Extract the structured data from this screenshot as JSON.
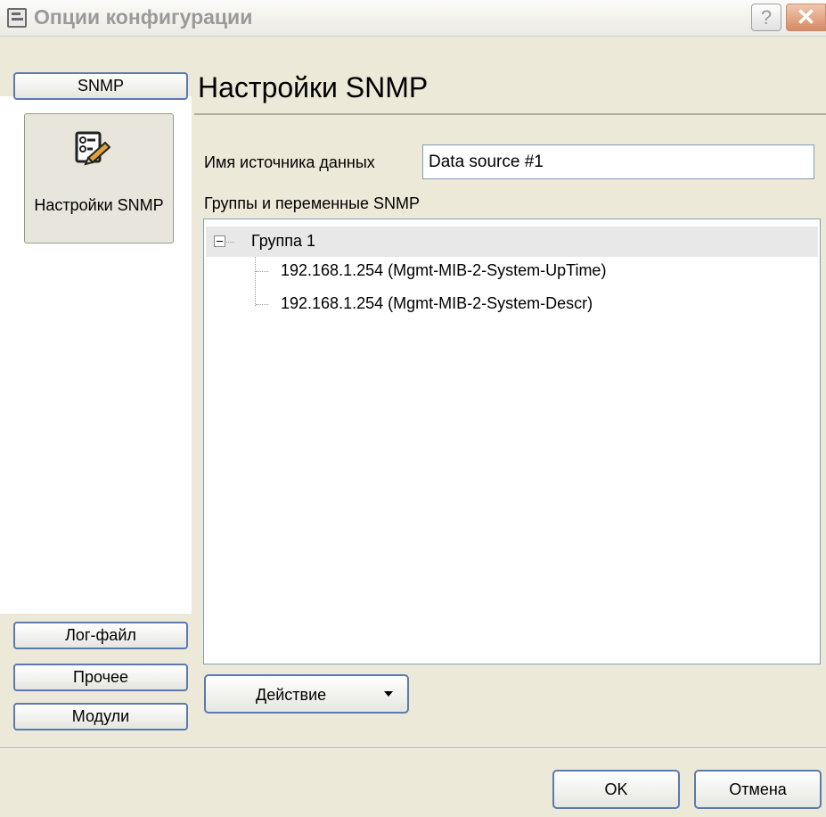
{
  "window": {
    "title": "Опции конфигурации",
    "help_label": "?",
    "close_label": "✕"
  },
  "sidebar": {
    "top_button": "SNMP",
    "big_button_label": "Настройки SNMP",
    "big_button_icon": "snmp-settings-icon",
    "bottom_buttons": [
      "Лог-файл",
      "Прочее",
      "Модули"
    ]
  },
  "main": {
    "title": "Настройки SNMP",
    "source_label": "Имя источника данных",
    "source_value": "Data source #1",
    "groups_label": "Группы и переменные SNMP",
    "tree": {
      "group": "Группа 1",
      "items": [
        "192.168.1.254 (Mgmt-MIB-2-System-UpTime)",
        "192.168.1.254 (Mgmt-MIB-2-System-Descr)"
      ]
    },
    "action_button": "Действие"
  },
  "footer": {
    "ok_label": "OK",
    "cancel_label": "Отмена"
  }
}
